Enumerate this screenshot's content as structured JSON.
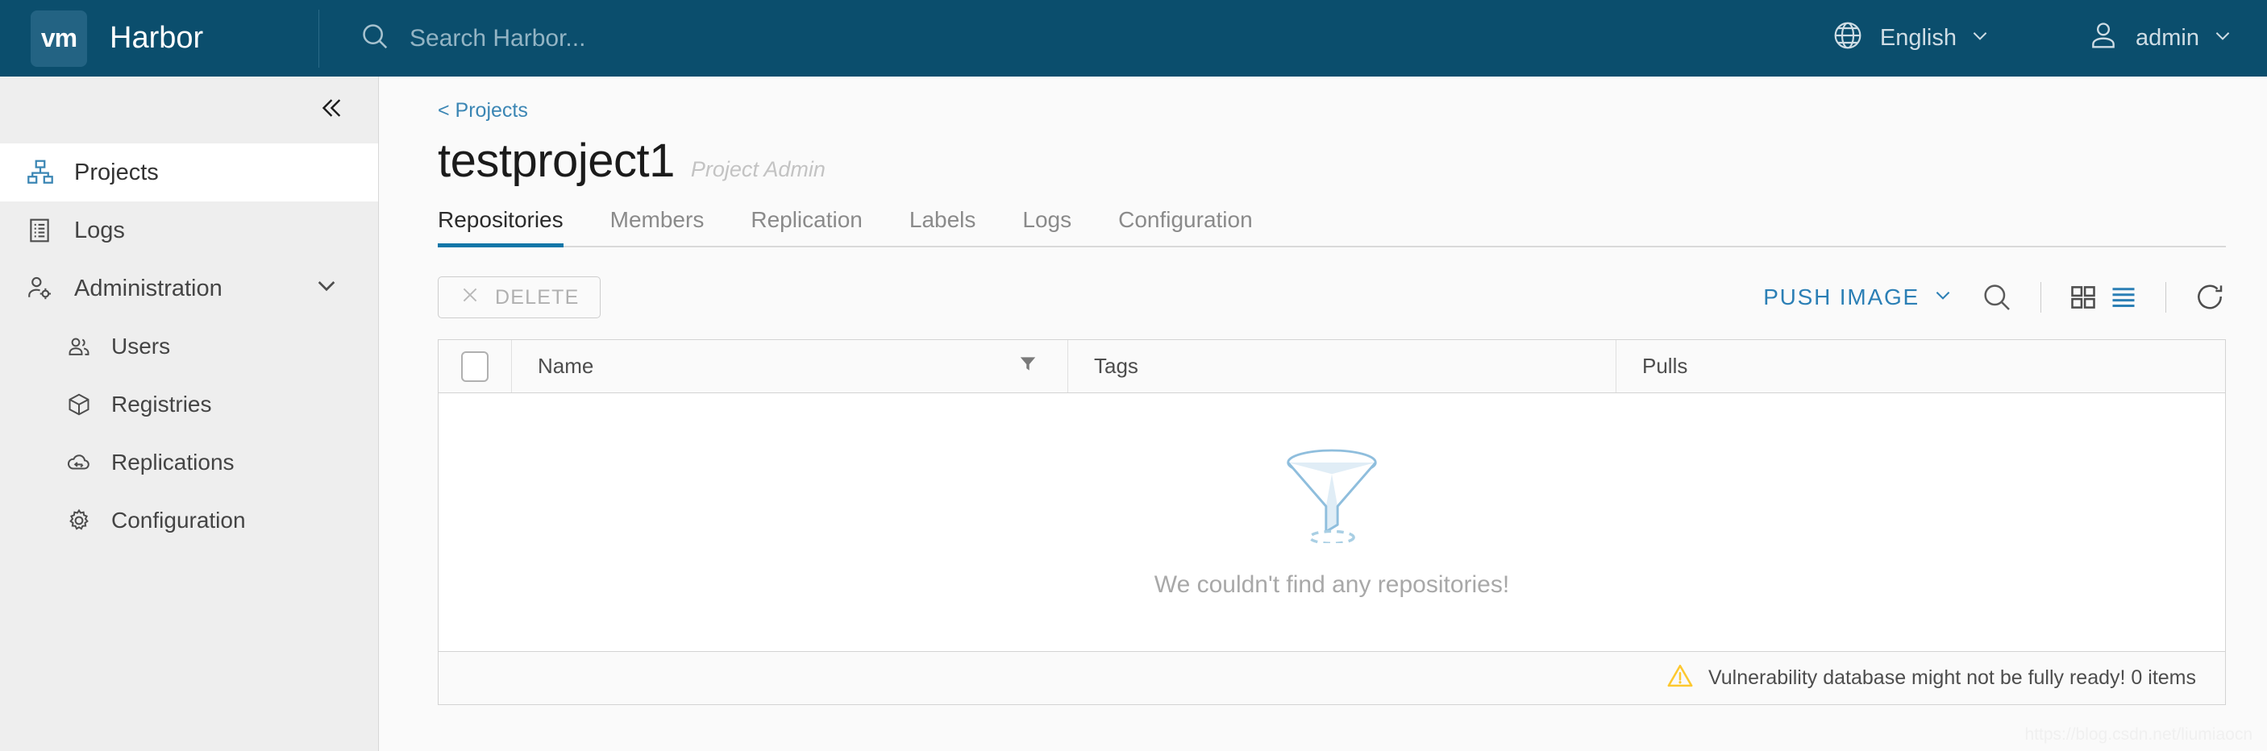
{
  "header": {
    "logo_text": "vm",
    "brand": "Harbor",
    "search_placeholder": "Search Harbor...",
    "search_value": "",
    "language": "English",
    "user": "admin",
    "bg_color": "#0b4e6d"
  },
  "sidebar": {
    "collapse_icon": "chevron-double-left-icon",
    "items": [
      {
        "label": "Projects",
        "icon": "projects-icon",
        "active": true
      },
      {
        "label": "Logs",
        "icon": "logs-icon",
        "active": false
      },
      {
        "label": "Administration",
        "icon": "administration-icon",
        "active": false,
        "expanded": true
      }
    ],
    "sub_items": [
      {
        "label": "Users",
        "icon": "users-icon"
      },
      {
        "label": "Registries",
        "icon": "registries-icon"
      },
      {
        "label": "Replications",
        "icon": "replications-icon"
      },
      {
        "label": "Configuration",
        "icon": "configuration-icon"
      }
    ]
  },
  "main": {
    "breadcrumb": "< Projects",
    "project_name": "testproject1",
    "project_role": "Project Admin",
    "tabs": [
      {
        "label": "Repositories",
        "active": true
      },
      {
        "label": "Members",
        "active": false
      },
      {
        "label": "Replication",
        "active": false
      },
      {
        "label": "Labels",
        "active": false
      },
      {
        "label": "Logs",
        "active": false
      },
      {
        "label": "Configuration",
        "active": false
      }
    ],
    "toolbar": {
      "delete_label": "DELETE",
      "push_image_label": "PUSH IMAGE",
      "search_icon": "search-icon",
      "grid_view_icon": "grid-view-icon",
      "list_view_icon": "list-view-icon",
      "refresh_icon": "refresh-icon",
      "accent_color": "#2b7fb5"
    },
    "table": {
      "columns": [
        "Name",
        "Tags",
        "Pulls"
      ],
      "rows": [],
      "empty_message": "We couldn't find any repositories!",
      "empty_icon": "funnel-icon"
    },
    "footer": {
      "warning_icon": "warning-triangle-icon",
      "message": "Vulnerability database might not be fully ready! 0 items",
      "warning_color": "#fdc82f"
    }
  },
  "watermark": "https://blog.csdn.net/liumiaocn"
}
